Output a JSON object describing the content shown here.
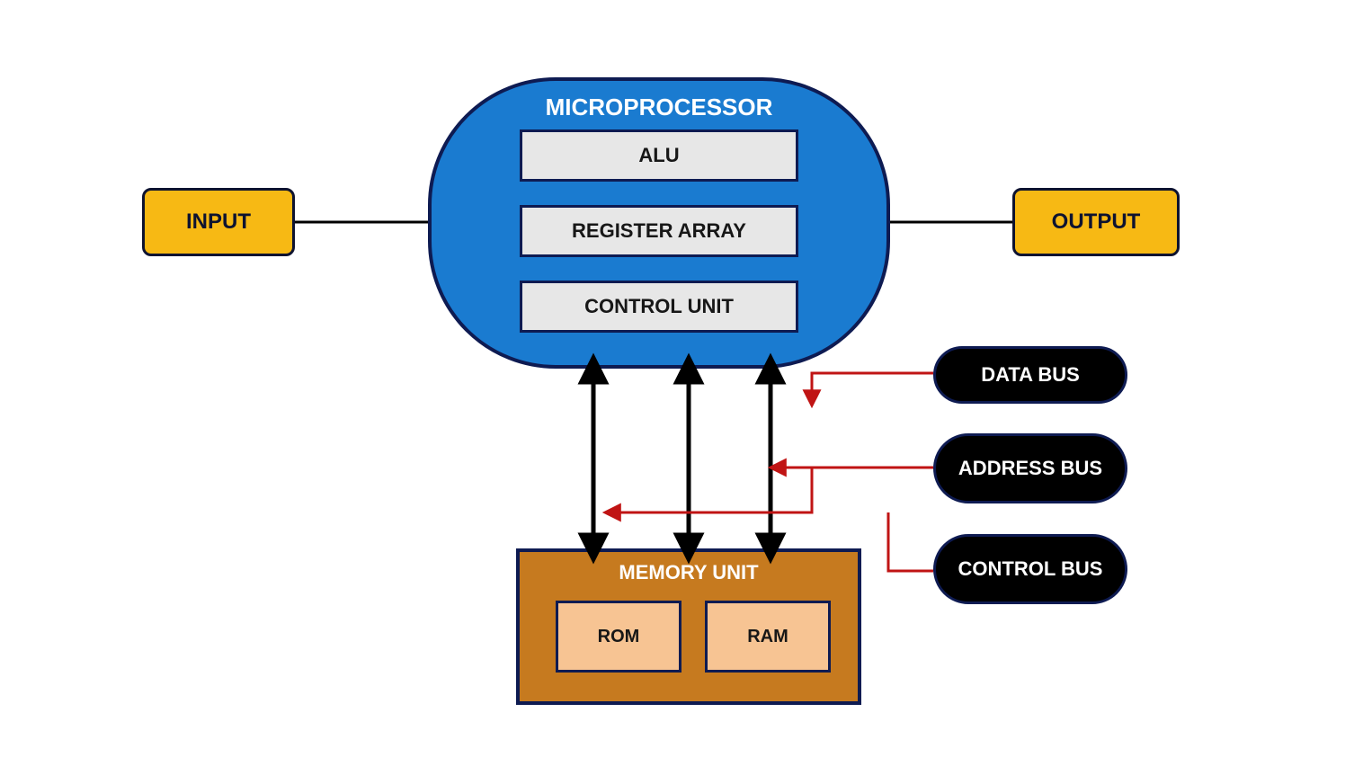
{
  "input": {
    "label": "INPUT"
  },
  "output": {
    "label": "OUTPUT"
  },
  "microprocessor": {
    "title": "MICROPROCESSOR",
    "alu": "ALU",
    "register_array": "REGISTER ARRAY",
    "control_unit": "CONTROL UNIT"
  },
  "memory": {
    "title": "MEMORY UNIT",
    "rom": "ROM",
    "ram": "RAM"
  },
  "buses": {
    "data": "DATA BUS",
    "address": "ADDRESS BUS",
    "control": "CONTROL BUS"
  },
  "colors": {
    "blue": "#1a7bd0",
    "yellow": "#f7b914",
    "navy": "#0e1330",
    "brown": "#c67a1f",
    "red": "#c01414"
  }
}
